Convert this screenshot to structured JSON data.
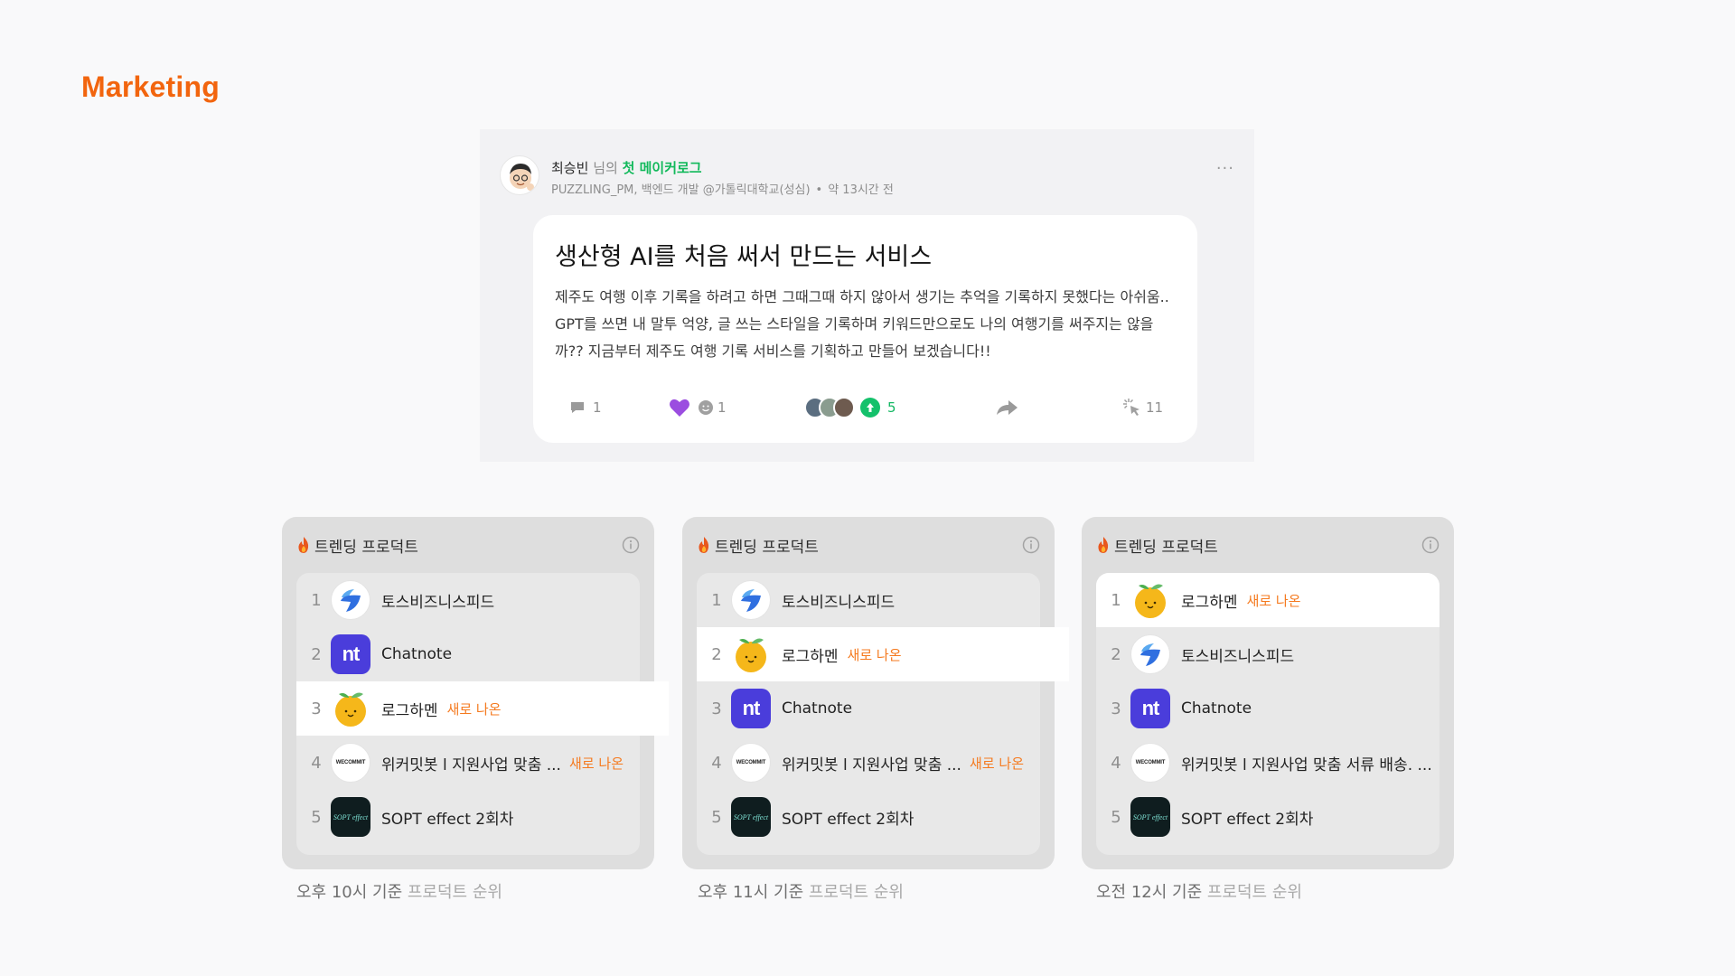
{
  "section_title": "Marketing",
  "post": {
    "author": "최승빈",
    "suffix": "님의",
    "badge": "첫 메이커로그",
    "meta": "PUZZLING_PM, 백엔드 개발 @가톨릭대학교(성심)",
    "dot": "•",
    "time": "약 13시간 전",
    "more": "···",
    "title": "생산형 AI를 처음 써서 만드는 서비스",
    "body": "제주도 여행 이후 기록을 하려고 하면 그때그때 하지 않아서 생기는 추억을 기록하지 못했다는 아쉬움.. GPT를 쓰면 내 말투 억양, 글 쓰는 스타일을 기록하며 키워드만으로도 나의 여행기를 써주지는 않을까?? 지금부터 제주도 여행 기록 서비스를 기획하고 만들어 보겠습니다!!",
    "comments": "1",
    "reactions": "1",
    "upvotes": "5",
    "views": "11",
    "colors": {
      "green": "#12b95b",
      "heart": "#9b4de0"
    }
  },
  "panels": [
    {
      "title": "트렌딩 프로덕트",
      "caption_time": "오후 10시 기준",
      "caption_rest": "프로덕트 순위",
      "rows": [
        {
          "rank": "1",
          "name": "토스비즈니스피드",
          "logo": "toss-icon",
          "tag": ""
        },
        {
          "rank": "2",
          "name": "Chatnote",
          "logo": "chatnote-icon",
          "tag": ""
        },
        {
          "rank": "3",
          "name": "로그하멘",
          "logo": "orange-icon",
          "tag": "새로 나온"
        },
        {
          "rank": "4",
          "name": "위커밋봇 l 지원사업 맞춤 ...",
          "logo": "wecommit-icon",
          "tag": "새로 나온"
        },
        {
          "rank": "5",
          "name": "SOPT effect 2회차",
          "logo": "sopt-icon",
          "tag": ""
        }
      ]
    },
    {
      "title": "트렌딩 프로덕트",
      "caption_time": "오후 11시 기준",
      "caption_rest": "프로덕트 순위",
      "rows": [
        {
          "rank": "1",
          "name": "토스비즈니스피드",
          "logo": "toss-icon",
          "tag": ""
        },
        {
          "rank": "2",
          "name": "로그하멘",
          "logo": "orange-icon",
          "tag": "새로 나온"
        },
        {
          "rank": "3",
          "name": "Chatnote",
          "logo": "chatnote-icon",
          "tag": ""
        },
        {
          "rank": "4",
          "name": "위커밋봇 l 지원사업 맞춤 ...",
          "logo": "wecommit-icon",
          "tag": "새로 나온"
        },
        {
          "rank": "5",
          "name": "SOPT effect 2회차",
          "logo": "sopt-icon",
          "tag": ""
        }
      ]
    },
    {
      "title": "트렌딩 프로덕트",
      "caption_time": "오전 12시 기준",
      "caption_rest": "프로덕트 순위",
      "rows": [
        {
          "rank": "1",
          "name": "로그하멘",
          "logo": "orange-icon",
          "tag": "새로 나온"
        },
        {
          "rank": "2",
          "name": "토스비즈니스피드",
          "logo": "toss-icon",
          "tag": ""
        },
        {
          "rank": "3",
          "name": "Chatnote",
          "logo": "chatnote-icon",
          "tag": ""
        },
        {
          "rank": "4",
          "name": "위커밋봇 l 지원사업 맞춤 서류 배송. ...",
          "logo": "wecommit-icon",
          "tag": ""
        },
        {
          "rank": "5",
          "name": "SOPT effect 2회차",
          "logo": "sopt-icon",
          "tag": ""
        }
      ]
    }
  ],
  "logo_text": {
    "chatnote": "nt",
    "wecommit": "WECOMMIT",
    "sopt": "SOPT effect"
  }
}
